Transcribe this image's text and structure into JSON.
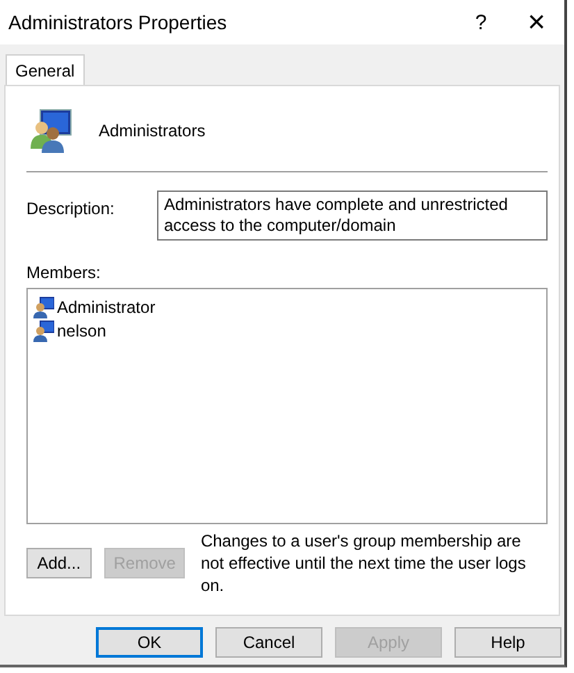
{
  "window": {
    "title": "Administrators Properties",
    "help": "?",
    "close": "×"
  },
  "tabs": [
    {
      "label": "General",
      "selected": true
    }
  ],
  "group": {
    "name": "Administrators"
  },
  "description": {
    "label": "Description:",
    "value": "Administrators have complete and unrestricted access to the computer/domain"
  },
  "members": {
    "label": "Members:",
    "items": [
      {
        "name": "Administrator"
      },
      {
        "name": "nelson"
      }
    ]
  },
  "member_buttons": [
    {
      "label": "Add...",
      "disabled": false
    },
    {
      "label": "Remove",
      "disabled": true
    }
  ],
  "note": "Changes to a user's group membership are not effective until the next time the user logs on.",
  "buttons": [
    {
      "label": "OK",
      "disabled": false,
      "default": true
    },
    {
      "label": "Cancel",
      "disabled": false,
      "default": false
    },
    {
      "label": "Apply",
      "disabled": true,
      "default": false
    },
    {
      "label": "Help",
      "disabled": false,
      "default": false
    }
  ]
}
